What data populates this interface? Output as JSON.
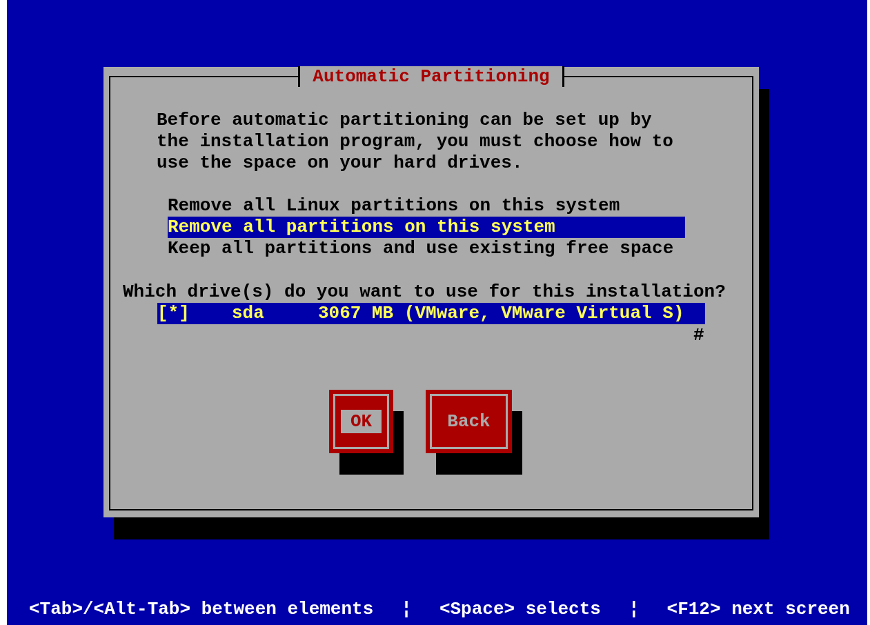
{
  "dialog": {
    "title": "Automatic Partitioning",
    "message": "Before automatic partitioning can be set up by\nthe installation program, you must choose how to\nuse the space on your hard drives.",
    "options": [
      {
        "label": "Remove all Linux partitions on this system",
        "selected": false
      },
      {
        "label": "Remove all partitions on this system",
        "selected": true
      },
      {
        "label": "Keep all partitions and use existing free space",
        "selected": false
      }
    ],
    "drive_question": "Which drive(s) do you want to use for this installation?",
    "drives": [
      {
        "checkbox": "[*]",
        "name": "sda",
        "size": "3067 MB (VMware, VMware Virtual S)",
        "selected": true
      }
    ],
    "scroll_mark": "#",
    "buttons": [
      {
        "label": "OK",
        "focused": true
      },
      {
        "label": "Back",
        "focused": false
      }
    ]
  },
  "status_bar": [
    "<Tab>/<Alt-Tab> between elements",
    "¦",
    "<Space> selects",
    "¦",
    "<F12> next screen"
  ]
}
